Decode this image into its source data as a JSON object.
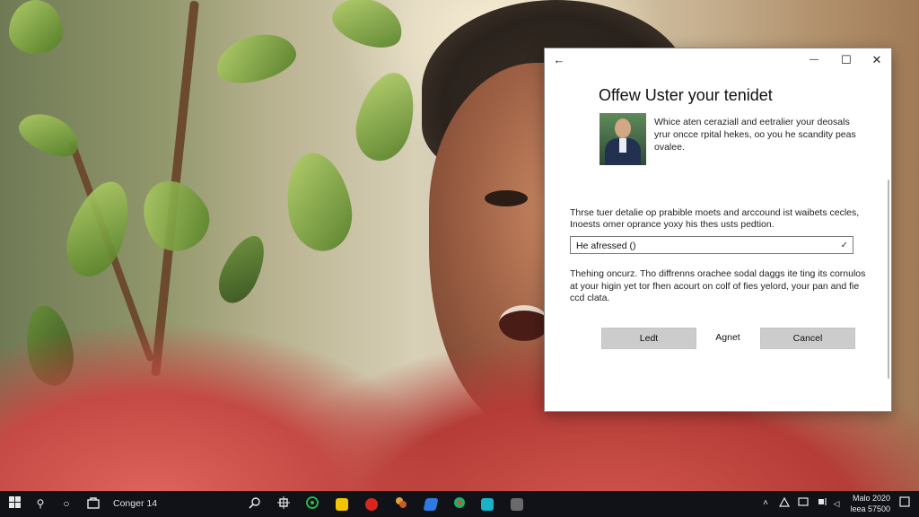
{
  "dialog": {
    "back_icon": "arrow-left-icon",
    "back_glyph": "←",
    "minimize_glyph": "—",
    "maximize_glyph": "☐",
    "close_glyph": "✕",
    "title": "Offew Uster your tenidet",
    "intro": "Whice aten ceraziall and eetralier your deosals yrur oncce rpital hekes, oo you he scandity peas ovalee.",
    "description": "Thrse tuer detalie op prabible moets and arccound ist waibets cecles, Inoests omer oprance yoxy his thes usts pedtion.",
    "field_value": "He afressed ()",
    "field_check_glyph": "✓",
    "note": "Thehing oncurz. Tho diffrenns orachee sodal daggs ite ting its cornulos at your higin yet tor fhen acourt on colf of fies yelord, your pan and fie ccd clata.",
    "buttons": {
      "left": "Ledt",
      "middle": "Agnet",
      "right": "Cancel"
    }
  },
  "taskbar": {
    "search_glyph": "⚲",
    "cortana_glyph": "○",
    "app_label": "Conger 14",
    "clock_time": "Malo 2020",
    "clock_date": "leea 57500",
    "colors": {
      "background": "#101218",
      "green_app": "#27c24c",
      "yellow_app": "#f2c500",
      "red_app": "#d8261f",
      "blue_app": "#2d7be0",
      "teal_app": "#19b3c8"
    }
  }
}
